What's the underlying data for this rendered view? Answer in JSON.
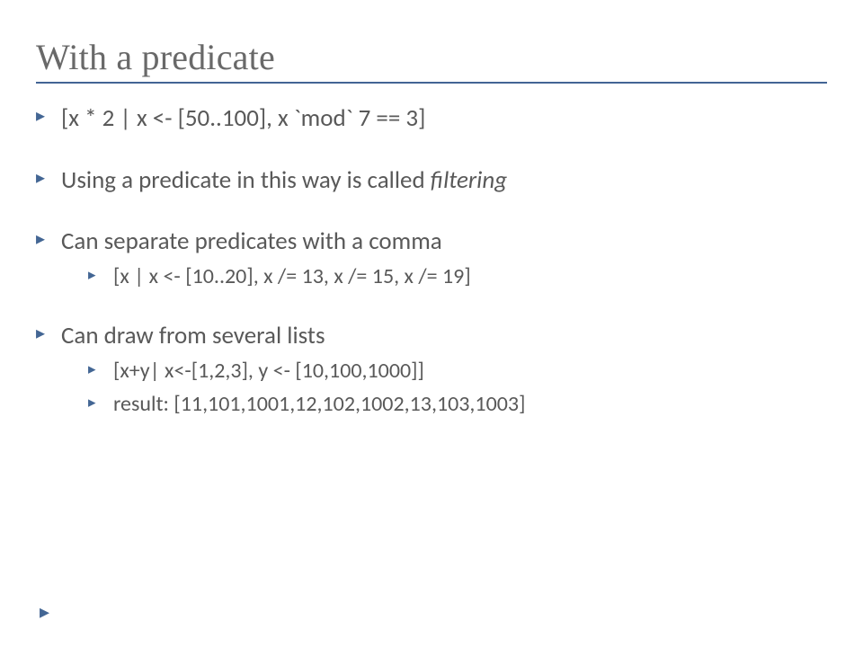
{
  "title": "With a predicate",
  "bullets": {
    "b1": "[x * 2 | x <- [50..100], x `mod` 7 == 3]",
    "b2_pre": "Using a predicate in this way is called ",
    "b2_em": "filtering",
    "b3": "Can separate predicates with a comma",
    "b3_sub1": "[x | x <- [10..20], x /= 13, x /= 15, x /= 19]",
    "b4": "Can draw from several lists",
    "b4_sub1": "[x+y| x<-[1,2,3], y <- [10,100,1000]]",
    "b4_sub2": "result: [11,101,1001,12,102,1002,13,103,1003]"
  },
  "colors": {
    "accent": "#426494",
    "text": "#595959"
  }
}
